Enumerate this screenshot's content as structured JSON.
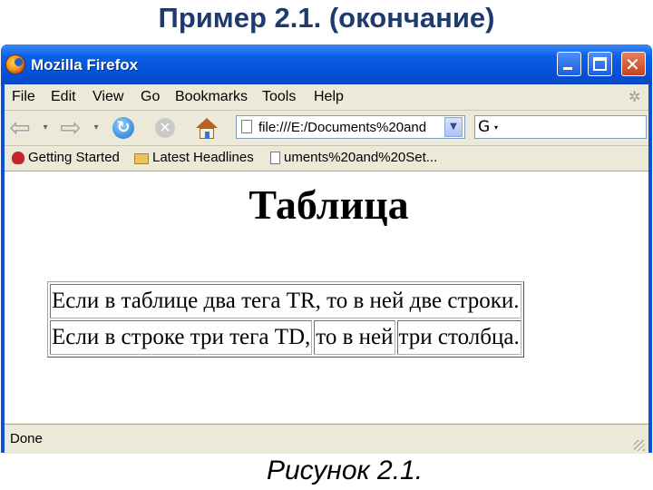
{
  "slide": {
    "title": "Пример 2.1. (окончание)",
    "caption": "Рисунок 2.1."
  },
  "window": {
    "title": "Mozilla Firefox",
    "controls": {
      "minimize_icon": "minimize-icon",
      "maximize_icon": "maximize-icon",
      "close_glyph": "✕"
    }
  },
  "menubar": {
    "items": [
      "File",
      "Edit",
      "View",
      "Go",
      "Bookmarks",
      "Tools",
      "Help"
    ]
  },
  "navbar": {
    "back_glyph": "⇦",
    "forward_glyph": "⇨",
    "dropdown_glyph": "▾",
    "reload_glyph": "↻",
    "stop_glyph": "✕",
    "url": "file:///E:/Documents%20and",
    "url_dropdown_glyph": "▼",
    "search_engine_glyph": "G",
    "search_dropdown_glyph": "▾"
  },
  "bookmarks": {
    "items": [
      "Getting Started",
      "Latest Headlines",
      "uments%20and%20Set..."
    ]
  },
  "page": {
    "heading": "Таблица",
    "table": {
      "rows": [
        [
          "Если в таблице два тега TR, то в ней две строки."
        ],
        [
          "Если в строке три тега TD,",
          "то в ней",
          "три столбца."
        ]
      ]
    }
  },
  "status": {
    "text": "Done"
  },
  "colors": {
    "titlebar": "#0a5fe8",
    "chrome": "#ece9d8",
    "slide_title": "#1f3a6e"
  }
}
